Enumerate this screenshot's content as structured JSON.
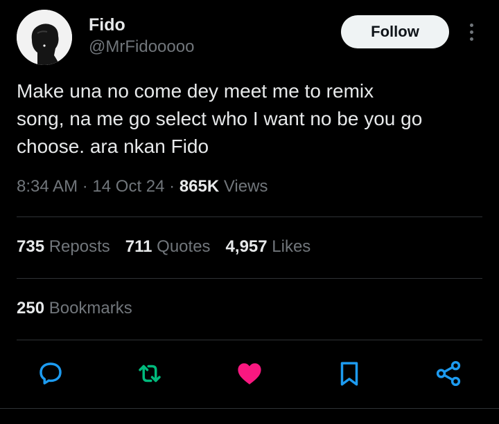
{
  "author": {
    "name": "Fido",
    "handle": "@MrFidooooo"
  },
  "header": {
    "follow_label": "Follow",
    "more_icon": "more-vertical-icon"
  },
  "tweet": {
    "text": "Make una no come dey meet me to remix\nsong, na me go select who I want no be you go\nchoose. ara nkan Fido",
    "time": "8:34 AM",
    "date": "14 Oct 24",
    "views_count": "865K",
    "views_label": "Views"
  },
  "stats": {
    "reposts_count": "735",
    "reposts_label": "Reposts",
    "quotes_count": "711",
    "quotes_label": "Quotes",
    "likes_count": "4,957",
    "likes_label": "Likes",
    "bookmarks_count": "250",
    "bookmarks_label": "Bookmarks"
  },
  "actions": {
    "reply_icon": "reply-icon",
    "repost_icon": "repost-icon",
    "like_icon": "heart-icon",
    "bookmark_icon": "bookmark-icon",
    "share_icon": "share-icon"
  },
  "colors": {
    "background": "#000000",
    "text_primary": "#e7e9ea",
    "text_secondary": "#71767b",
    "divider": "#2f3336",
    "like_active": "#f91880",
    "follow_bg": "#eff3f4"
  }
}
